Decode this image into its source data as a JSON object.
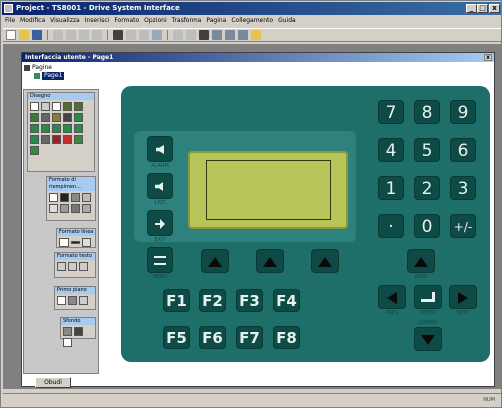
{
  "window": {
    "title": "Project - TS8001 - Drive System Interface",
    "min_label": "_",
    "max_label": "□",
    "close_label": "x"
  },
  "menu": [
    "File",
    "Modifica",
    "Visualizza",
    "Inserisci",
    "Formato",
    "Opzioni",
    "Trasforma",
    "Pagina",
    "Collegamento",
    "Guida"
  ],
  "document": {
    "title": "Interfaccia utente - Page1",
    "close_label": "x",
    "tree": {
      "root": "Pagine",
      "child": "Page1"
    }
  },
  "palette": {
    "disegno_title": "Disegno",
    "formato_riempim_title": "Formato di riempimen...",
    "formato_linea_title": "Formato linea",
    "formato_testo_title": "Formato testo",
    "primo_piano_title": "Primo piano",
    "sfondo_title": "Sfondo"
  },
  "keypad": {
    "numbers": [
      "7",
      "8",
      "9",
      "4",
      "5",
      "6",
      "1",
      "2",
      "3",
      "·",
      "0",
      "+/-"
    ],
    "fkeys": [
      "F1",
      "F2",
      "F3",
      "F4",
      "F5",
      "F6",
      "F7",
      "F8"
    ],
    "side_labels": [
      "ALARM",
      "LIST",
      "EXIT",
      "MENU"
    ],
    "enter_label": "ENTER",
    "data_label": "DATA",
    "prev_label": "PREV",
    "next_label": "NEXT",
    "lower_label": "LOWER"
  },
  "tab_label": "Obudi",
  "status": {
    "right": "NUM"
  },
  "colors": {
    "device": "#1e6e6a",
    "key": "#0e4a46",
    "lcd": "#b8c659",
    "titlebar": "#0a246a"
  }
}
